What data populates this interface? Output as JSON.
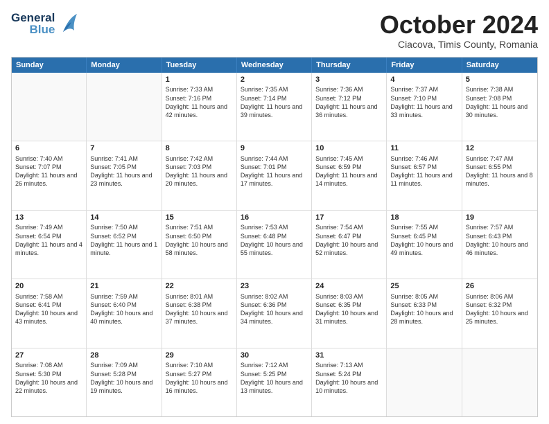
{
  "header": {
    "logo_line1": "General",
    "logo_line2": "Blue",
    "month": "October 2024",
    "location": "Ciacova, Timis County, Romania"
  },
  "weekdays": [
    "Sunday",
    "Monday",
    "Tuesday",
    "Wednesday",
    "Thursday",
    "Friday",
    "Saturday"
  ],
  "rows": [
    [
      {
        "day": "",
        "info": "",
        "empty": true
      },
      {
        "day": "",
        "info": "",
        "empty": true
      },
      {
        "day": "1",
        "info": "Sunrise: 7:33 AM\nSunset: 7:16 PM\nDaylight: 11 hours and 42 minutes."
      },
      {
        "day": "2",
        "info": "Sunrise: 7:35 AM\nSunset: 7:14 PM\nDaylight: 11 hours and 39 minutes."
      },
      {
        "day": "3",
        "info": "Sunrise: 7:36 AM\nSunset: 7:12 PM\nDaylight: 11 hours and 36 minutes."
      },
      {
        "day": "4",
        "info": "Sunrise: 7:37 AM\nSunset: 7:10 PM\nDaylight: 11 hours and 33 minutes."
      },
      {
        "day": "5",
        "info": "Sunrise: 7:38 AM\nSunset: 7:08 PM\nDaylight: 11 hours and 30 minutes."
      }
    ],
    [
      {
        "day": "6",
        "info": "Sunrise: 7:40 AM\nSunset: 7:07 PM\nDaylight: 11 hours and 26 minutes."
      },
      {
        "day": "7",
        "info": "Sunrise: 7:41 AM\nSunset: 7:05 PM\nDaylight: 11 hours and 23 minutes."
      },
      {
        "day": "8",
        "info": "Sunrise: 7:42 AM\nSunset: 7:03 PM\nDaylight: 11 hours and 20 minutes."
      },
      {
        "day": "9",
        "info": "Sunrise: 7:44 AM\nSunset: 7:01 PM\nDaylight: 11 hours and 17 minutes."
      },
      {
        "day": "10",
        "info": "Sunrise: 7:45 AM\nSunset: 6:59 PM\nDaylight: 11 hours and 14 minutes."
      },
      {
        "day": "11",
        "info": "Sunrise: 7:46 AM\nSunset: 6:57 PM\nDaylight: 11 hours and 11 minutes."
      },
      {
        "day": "12",
        "info": "Sunrise: 7:47 AM\nSunset: 6:55 PM\nDaylight: 11 hours and 8 minutes."
      }
    ],
    [
      {
        "day": "13",
        "info": "Sunrise: 7:49 AM\nSunset: 6:54 PM\nDaylight: 11 hours and 4 minutes."
      },
      {
        "day": "14",
        "info": "Sunrise: 7:50 AM\nSunset: 6:52 PM\nDaylight: 11 hours and 1 minute."
      },
      {
        "day": "15",
        "info": "Sunrise: 7:51 AM\nSunset: 6:50 PM\nDaylight: 10 hours and 58 minutes."
      },
      {
        "day": "16",
        "info": "Sunrise: 7:53 AM\nSunset: 6:48 PM\nDaylight: 10 hours and 55 minutes."
      },
      {
        "day": "17",
        "info": "Sunrise: 7:54 AM\nSunset: 6:47 PM\nDaylight: 10 hours and 52 minutes."
      },
      {
        "day": "18",
        "info": "Sunrise: 7:55 AM\nSunset: 6:45 PM\nDaylight: 10 hours and 49 minutes."
      },
      {
        "day": "19",
        "info": "Sunrise: 7:57 AM\nSunset: 6:43 PM\nDaylight: 10 hours and 46 minutes."
      }
    ],
    [
      {
        "day": "20",
        "info": "Sunrise: 7:58 AM\nSunset: 6:41 PM\nDaylight: 10 hours and 43 minutes."
      },
      {
        "day": "21",
        "info": "Sunrise: 7:59 AM\nSunset: 6:40 PM\nDaylight: 10 hours and 40 minutes."
      },
      {
        "day": "22",
        "info": "Sunrise: 8:01 AM\nSunset: 6:38 PM\nDaylight: 10 hours and 37 minutes."
      },
      {
        "day": "23",
        "info": "Sunrise: 8:02 AM\nSunset: 6:36 PM\nDaylight: 10 hours and 34 minutes."
      },
      {
        "day": "24",
        "info": "Sunrise: 8:03 AM\nSunset: 6:35 PM\nDaylight: 10 hours and 31 minutes."
      },
      {
        "day": "25",
        "info": "Sunrise: 8:05 AM\nSunset: 6:33 PM\nDaylight: 10 hours and 28 minutes."
      },
      {
        "day": "26",
        "info": "Sunrise: 8:06 AM\nSunset: 6:32 PM\nDaylight: 10 hours and 25 minutes."
      }
    ],
    [
      {
        "day": "27",
        "info": "Sunrise: 7:08 AM\nSunset: 5:30 PM\nDaylight: 10 hours and 22 minutes."
      },
      {
        "day": "28",
        "info": "Sunrise: 7:09 AM\nSunset: 5:28 PM\nDaylight: 10 hours and 19 minutes."
      },
      {
        "day": "29",
        "info": "Sunrise: 7:10 AM\nSunset: 5:27 PM\nDaylight: 10 hours and 16 minutes."
      },
      {
        "day": "30",
        "info": "Sunrise: 7:12 AM\nSunset: 5:25 PM\nDaylight: 10 hours and 13 minutes."
      },
      {
        "day": "31",
        "info": "Sunrise: 7:13 AM\nSunset: 5:24 PM\nDaylight: 10 hours and 10 minutes."
      },
      {
        "day": "",
        "info": "",
        "empty": true
      },
      {
        "day": "",
        "info": "",
        "empty": true
      }
    ]
  ]
}
